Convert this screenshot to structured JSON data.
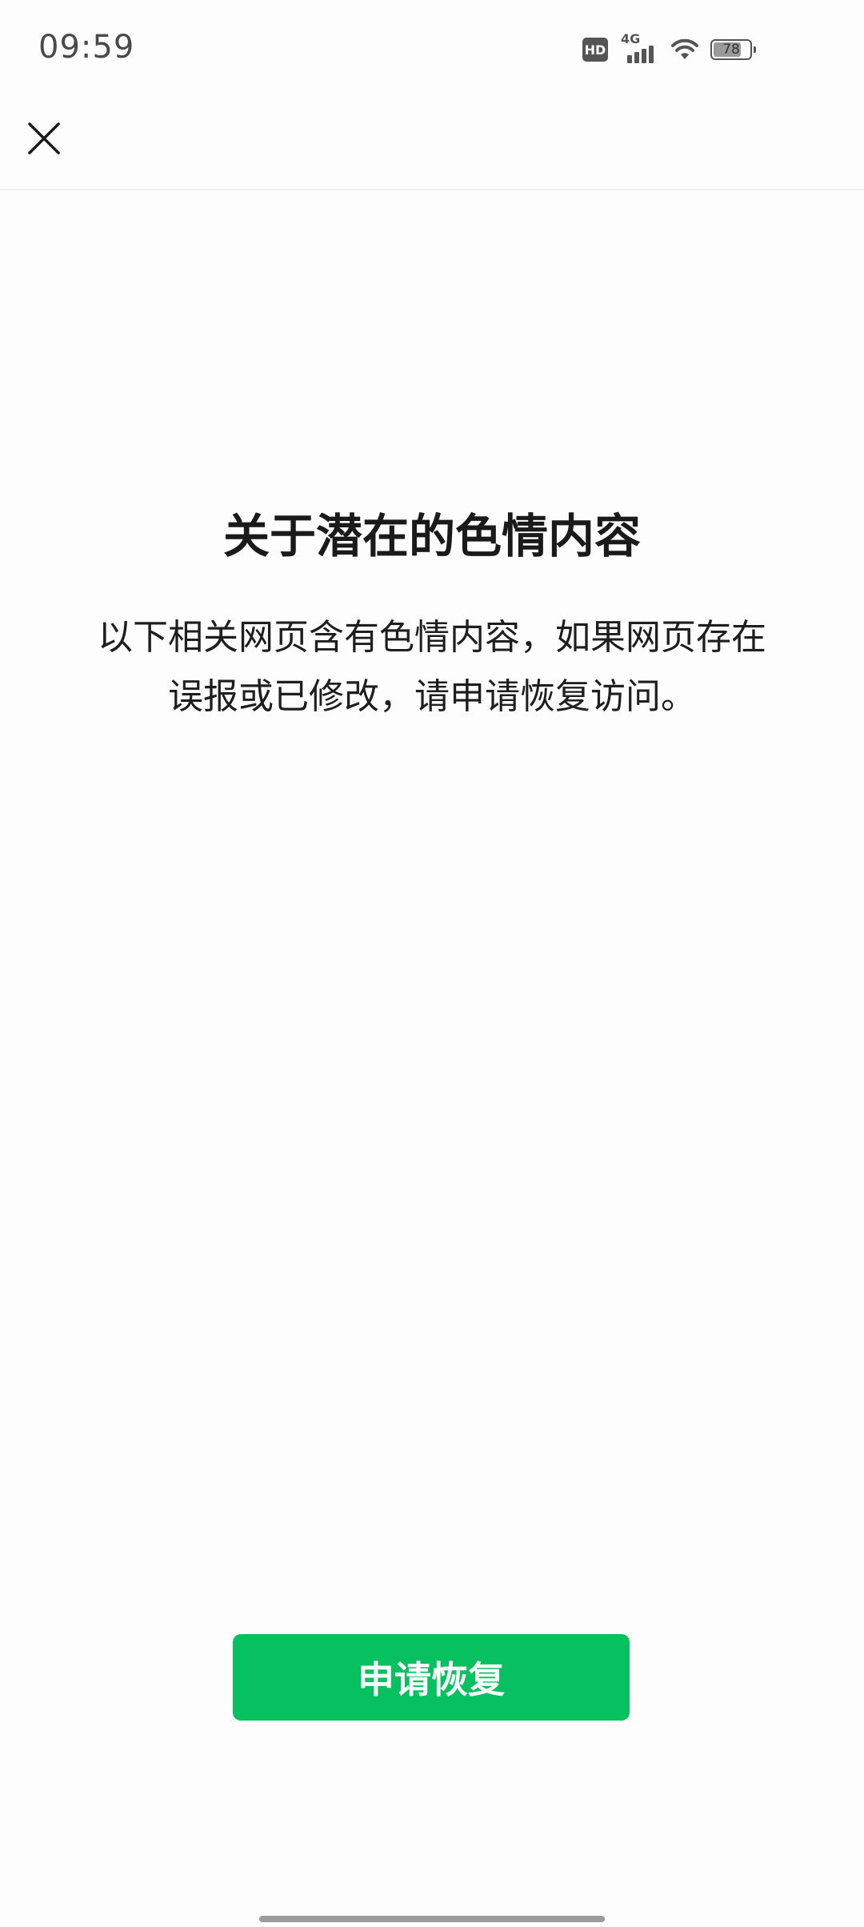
{
  "status_bar": {
    "time": "09:59",
    "hd_label": "HD",
    "network_label": "4G",
    "battery_level": "78",
    "battery_fraction": 0.78,
    "icons": [
      "hd-icon",
      "signal-icon",
      "wifi-icon",
      "battery-icon"
    ]
  },
  "nav": {
    "close_icon": "close-icon"
  },
  "content": {
    "title": "关于潜在的色情内容",
    "description_line1": "以下相关网页含有色情内容，如果网页存在",
    "description_line2": "误报或已修改，请申请恢复访问。"
  },
  "actions": {
    "restore_label": "申请恢复"
  },
  "colors": {
    "accent": "#07c160",
    "background": "#fdfdfd",
    "text_primary": "#1a1a1a"
  }
}
